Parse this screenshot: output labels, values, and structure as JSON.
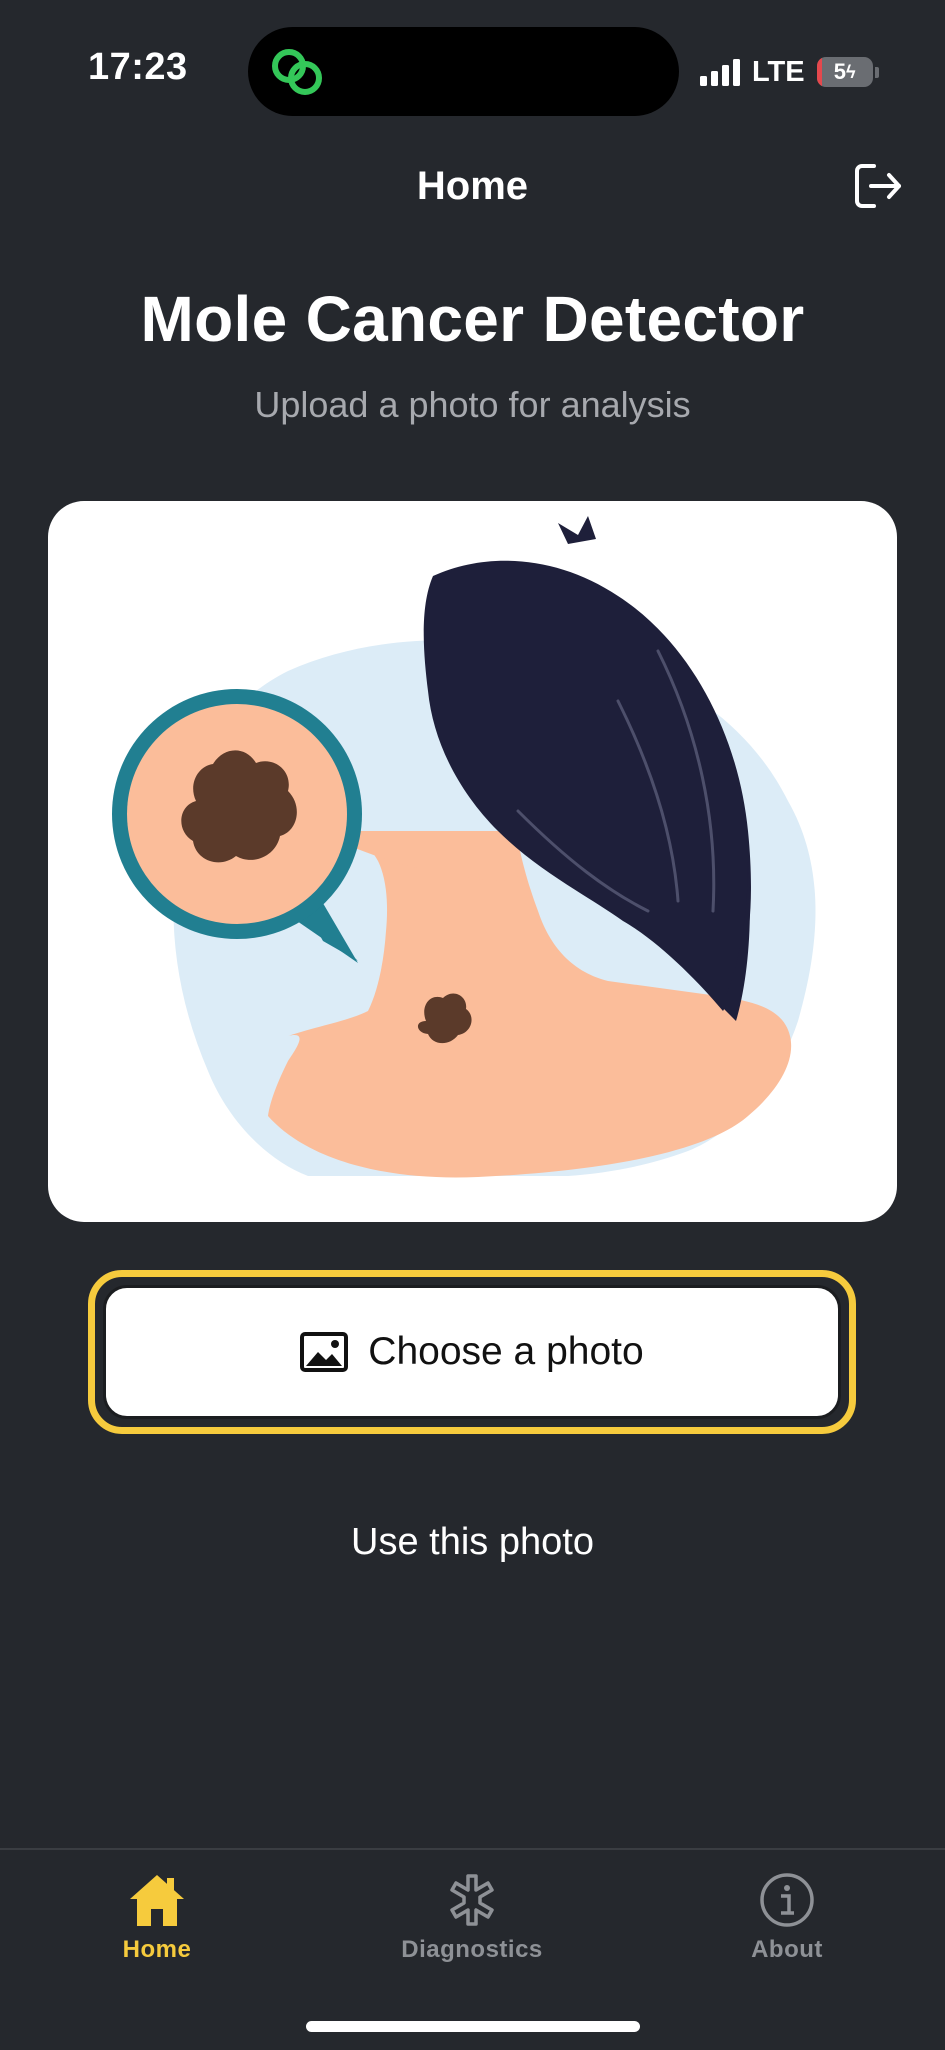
{
  "status_bar": {
    "time": "17:23",
    "network": "LTE",
    "battery_level": "5",
    "battery_icon": "battery-charging-icon"
  },
  "header": {
    "title": "Home",
    "logout_icon": "logout-icon"
  },
  "hero": {
    "title": "Mole Cancer Detector",
    "subtitle": "Upload a photo for analysis"
  },
  "actions": {
    "choose_photo_label": "Choose a photo",
    "choose_photo_icon": "image-icon",
    "use_photo_label": "Use this photo"
  },
  "tabs": [
    {
      "label": "Home",
      "icon": "home-icon",
      "active": true
    },
    {
      "label": "Diagnostics",
      "icon": "asterisk-icon",
      "active": false
    },
    {
      "label": "About",
      "icon": "info-icon",
      "active": false
    }
  ],
  "colors": {
    "background": "#25282d",
    "accent": "#f6cb3d",
    "tab_inactive": "#8e9196",
    "subtitle": "#a7a9ae"
  }
}
